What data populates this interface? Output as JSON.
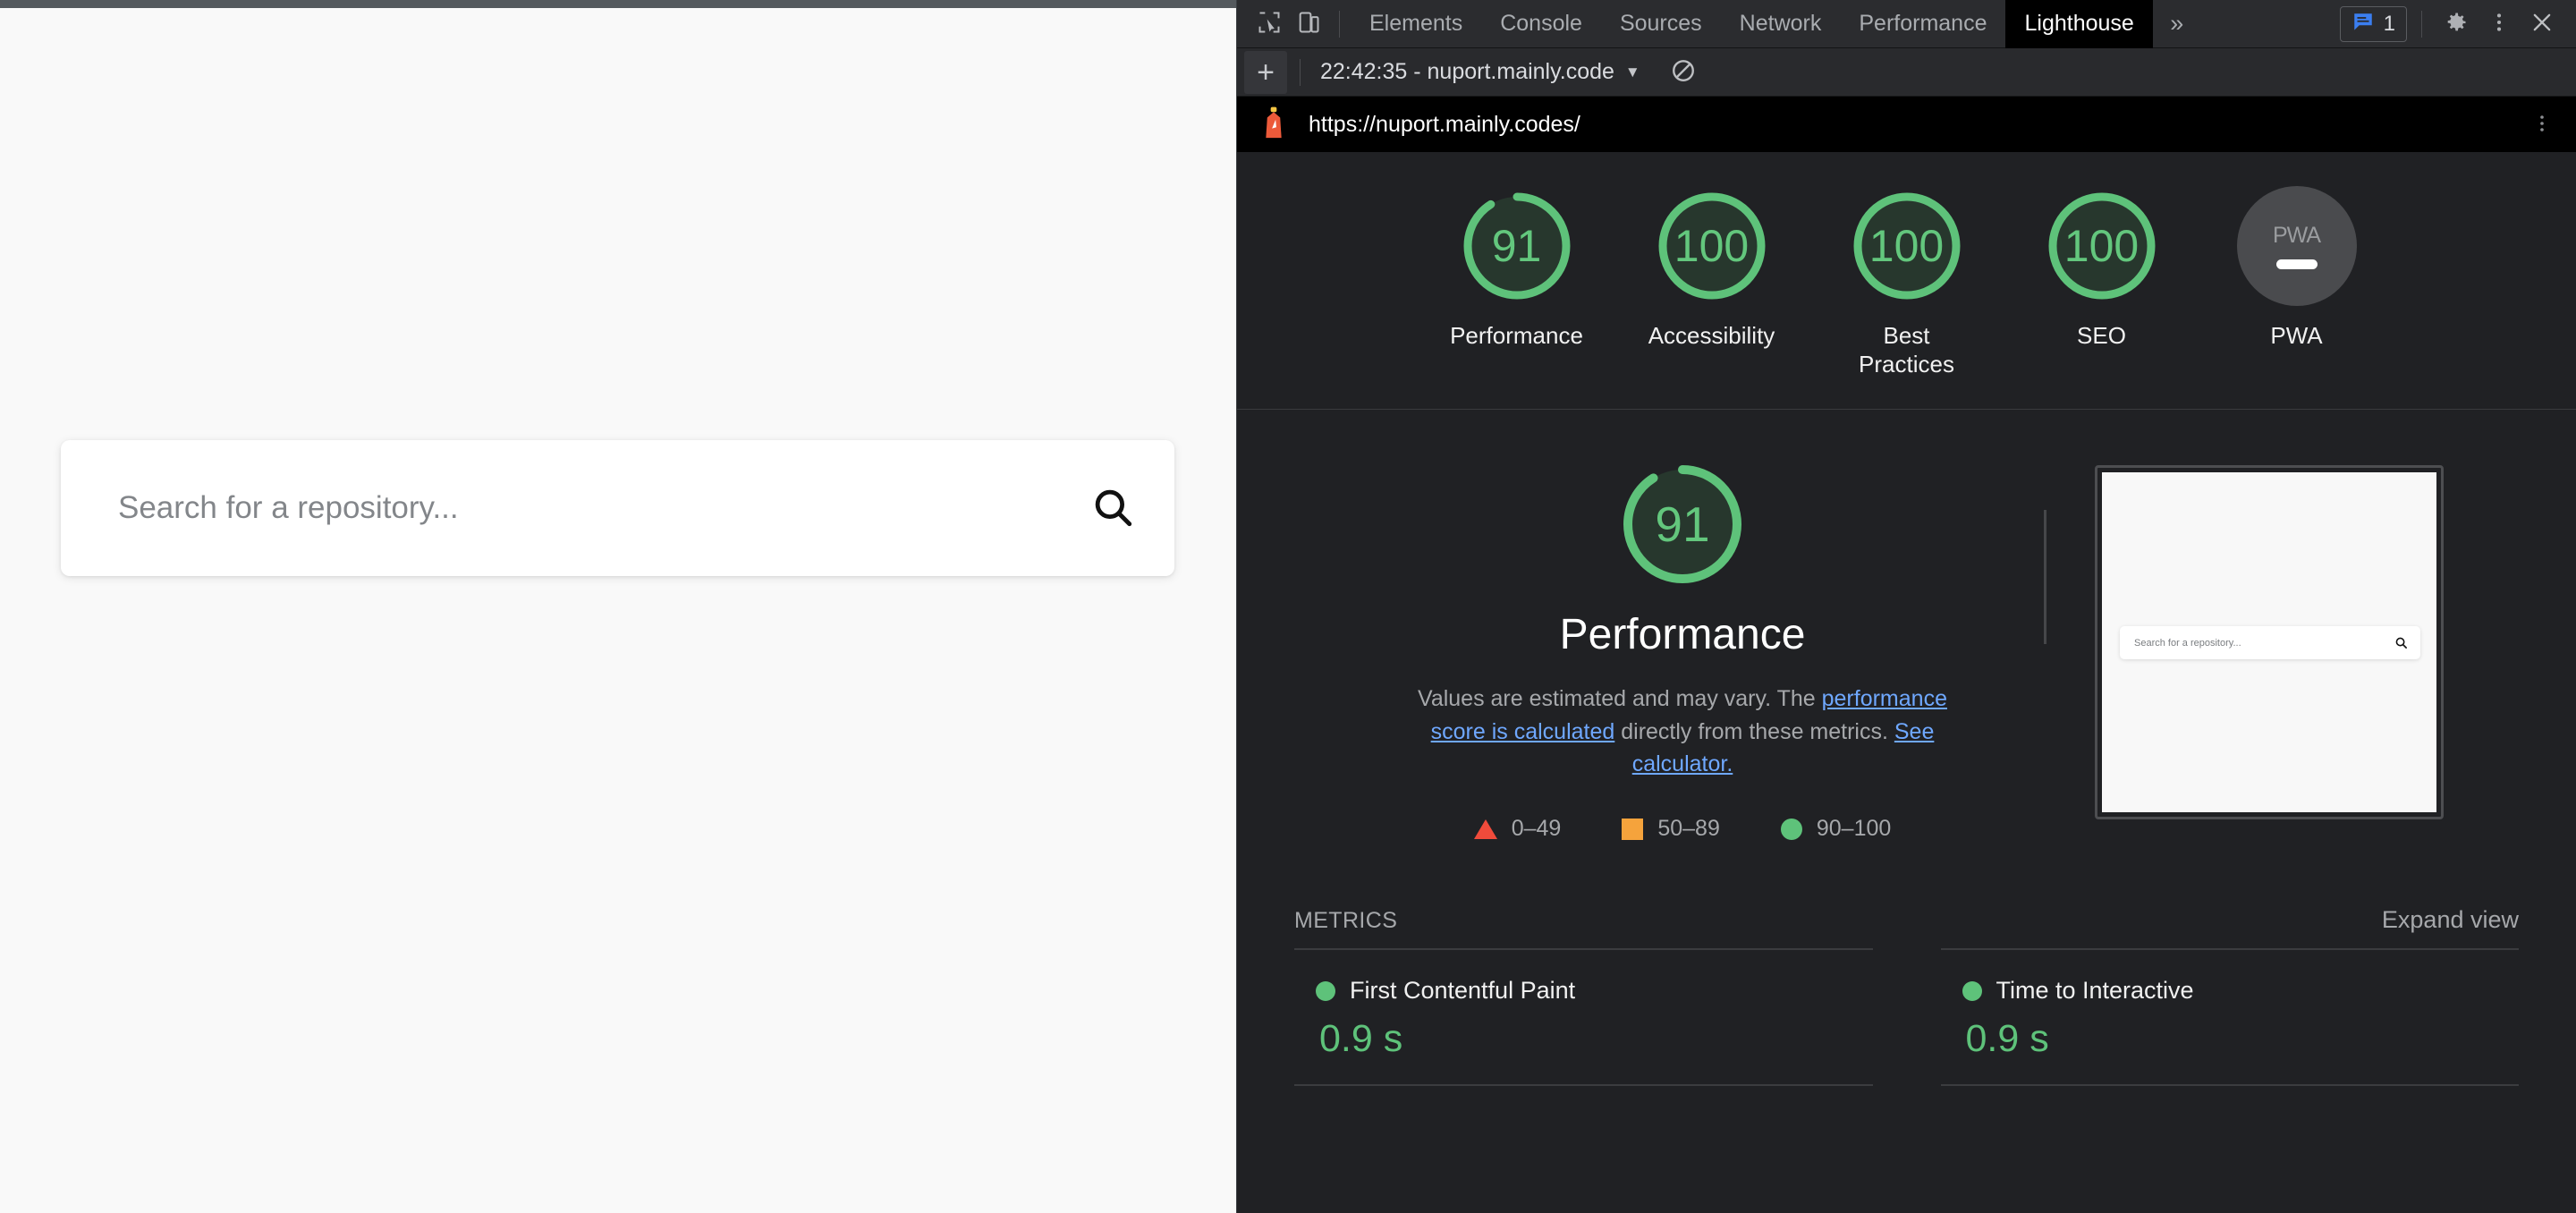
{
  "page": {
    "search": {
      "placeholder": "Search for a repository...",
      "value": "",
      "icon": "search-icon"
    }
  },
  "devtools": {
    "toolbar": {
      "inspect_icon": "inspect-element-icon",
      "device_icon": "device-toolbar-icon",
      "tabs": [
        {
          "label": "Elements",
          "active": false
        },
        {
          "label": "Console",
          "active": false
        },
        {
          "label": "Sources",
          "active": false
        },
        {
          "label": "Network",
          "active": false
        },
        {
          "label": "Performance",
          "active": false
        },
        {
          "label": "Lighthouse",
          "active": true
        }
      ],
      "more_tabs_label": "»",
      "issues_count": "1",
      "issues_icon": "issues-message-icon",
      "settings_icon": "gear-icon",
      "menu_icon": "more-vertical-icon",
      "close_icon": "close-icon"
    },
    "subbar": {
      "new_report_label": "+",
      "report_name": "22:42:35 - nuport.mainly.code",
      "caret": "▼",
      "clear_icon": "clear-all-icon"
    },
    "report": {
      "lighthouse_icon": "lighthouse-icon",
      "url": "https://nuport.mainly.codes/",
      "header_menu_icon": "more-vertical-icon",
      "gauges": [
        {
          "score": "91",
          "label": "Performance",
          "color": "#5ec27a",
          "pct": 91
        },
        {
          "score": "100",
          "label": "Accessibility",
          "color": "#5ec27a",
          "pct": 100
        },
        {
          "score": "100",
          "label": "Best Practices",
          "color": "#5ec27a",
          "pct": 100
        },
        {
          "score": "100",
          "label": "SEO",
          "color": "#5ec27a",
          "pct": 100
        }
      ],
      "pwa": {
        "badge_text": "PWA",
        "label": "PWA",
        "state": "not-applicable"
      },
      "category": {
        "score": "91",
        "pct": 91,
        "title": "Performance",
        "desc_part1": "Values are estimated and may vary. The ",
        "link1": "performance score is calculated",
        "desc_part2": " directly from these metrics. ",
        "link2": "See calculator.",
        "legend": [
          {
            "shape": "triangle",
            "label": "0–49",
            "color": "#f04b3b"
          },
          {
            "shape": "square",
            "label": "50–89",
            "color": "#f5a33c"
          },
          {
            "shape": "circle",
            "label": "90–100",
            "color": "#5ec27a"
          }
        ],
        "screenshot": {
          "alt": "page-screenshot-thumbnail",
          "search_placeholder": "Search for a repository...",
          "search_icon": "search-icon"
        }
      },
      "metrics": {
        "title": "METRICS",
        "expand_label": "Expand view",
        "items": [
          {
            "name": "First Contentful Paint",
            "value": "0.9 s",
            "status": "pass",
            "color": "#5ec27a"
          },
          {
            "name": "Time to Interactive",
            "value": "0.9 s",
            "status": "pass",
            "color": "#5ec27a"
          }
        ]
      }
    }
  }
}
